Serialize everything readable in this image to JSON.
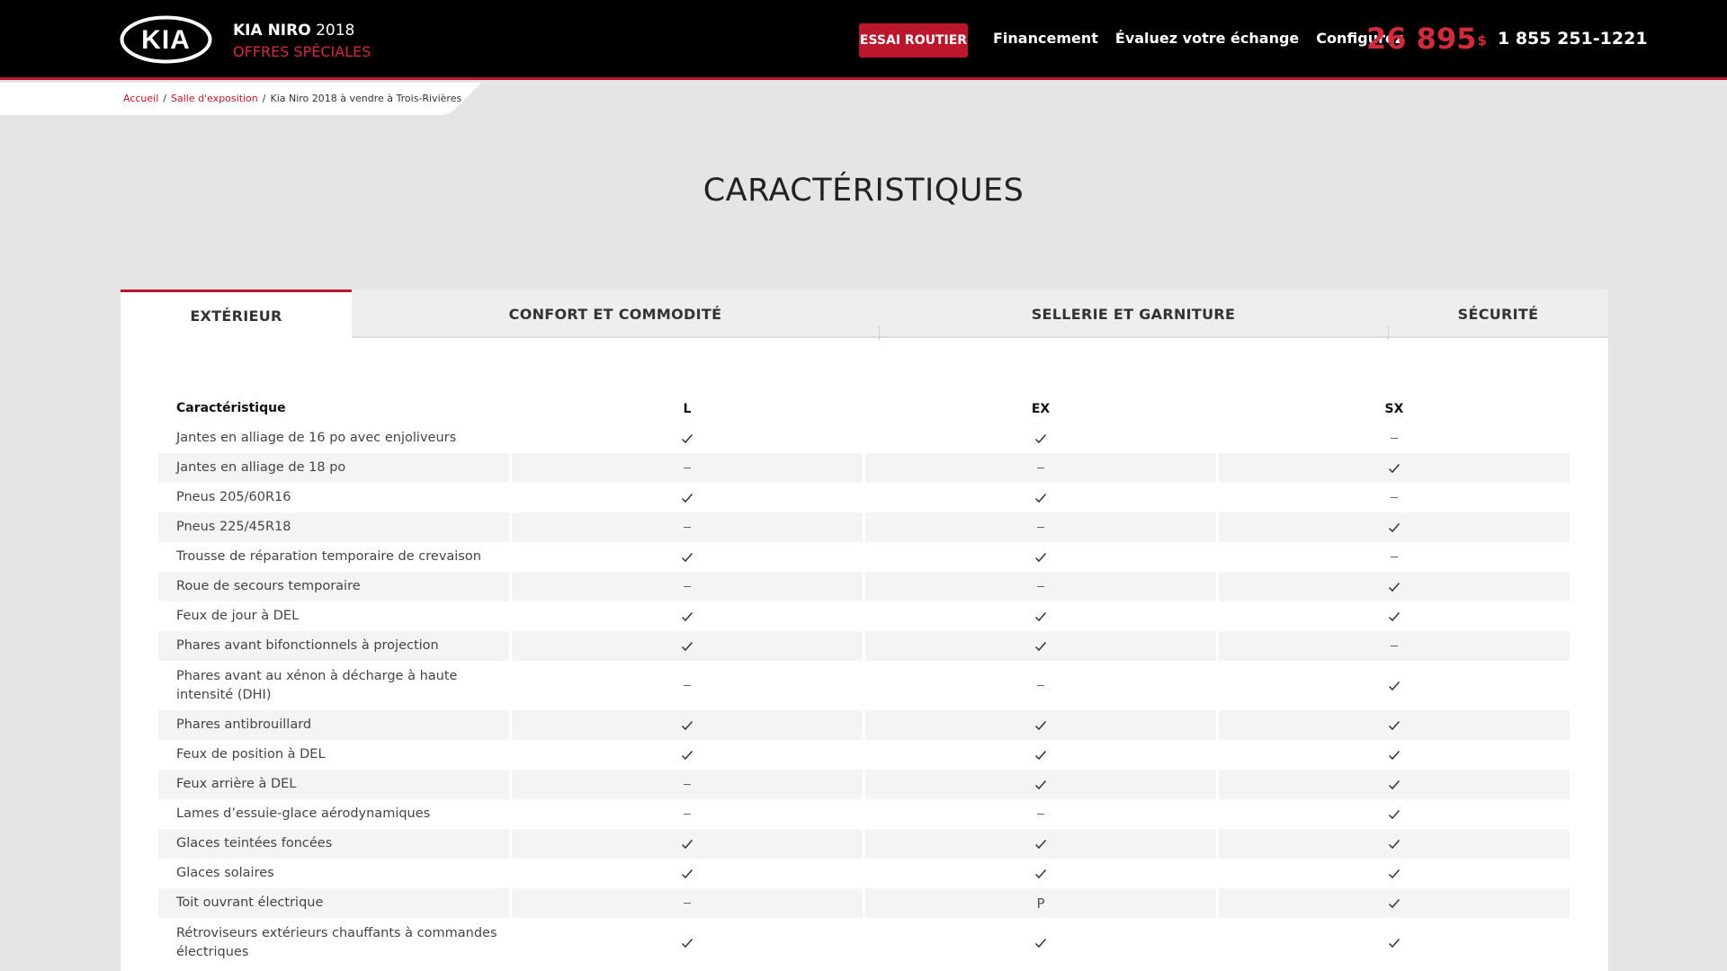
{
  "header": {
    "brand": "KIA",
    "model_name": "KIA NIRO",
    "model_year": "2018",
    "subtitle": "OFFRES SPÉCIALES",
    "test_drive_label": "ESSAI ROUTIER",
    "nav": [
      "Financement",
      "Évaluez votre échange",
      "Configurez"
    ],
    "price": "26 895",
    "price_currency": "$",
    "phone": "1 855 251-1221"
  },
  "breadcrumb": {
    "items": [
      "Accueil",
      "Salle d'exposition",
      "Kia Niro 2018 à vendre à Trois-Rivières"
    ]
  },
  "page_title": "CARACTÉRISTIQUES",
  "tabs": [
    "EXTÉRIEUR",
    "CONFORT ET COMMODITÉ",
    "SELLERIE ET GARNITURE",
    "SÉCURITÉ"
  ],
  "active_tab": "EXTÉRIEUR",
  "table": {
    "headers": [
      "Caractéristique",
      "L",
      "EX",
      "SX"
    ],
    "rows": [
      {
        "label": "Jantes en alliage de 16 po avec enjoliveurs",
        "values": [
          "check",
          "check",
          "dash"
        ]
      },
      {
        "label": "Jantes en alliage de 18 po",
        "values": [
          "dash",
          "dash",
          "check"
        ]
      },
      {
        "label": "Pneus 205/60R16",
        "values": [
          "check",
          "check",
          "dash"
        ]
      },
      {
        "label": "Pneus 225/45R18",
        "values": [
          "dash",
          "dash",
          "check"
        ]
      },
      {
        "label": "Trousse de réparation temporaire de crevaison",
        "values": [
          "check",
          "check",
          "dash"
        ]
      },
      {
        "label": "Roue de secours temporaire",
        "values": [
          "dash",
          "dash",
          "check"
        ]
      },
      {
        "label": "Feux de jour à DEL",
        "values": [
          "check",
          "check",
          "check"
        ]
      },
      {
        "label": "Phares avant bifonctionnels à projection",
        "values": [
          "check",
          "check",
          "dash"
        ]
      },
      {
        "label": "Phares avant au xénon à décharge à haute intensité (DHI)",
        "values": [
          "dash",
          "dash",
          "check"
        ]
      },
      {
        "label": "Phares antibrouillard",
        "values": [
          "check",
          "check",
          "check"
        ]
      },
      {
        "label": "Feux de position à DEL",
        "values": [
          "check",
          "check",
          "check"
        ]
      },
      {
        "label": "Feux arrière à DEL",
        "values": [
          "dash",
          "check",
          "check"
        ]
      },
      {
        "label": "Lames d’essuie-glace aérodynamiques",
        "values": [
          "dash",
          "dash",
          "check"
        ]
      },
      {
        "label": "Glaces teintées foncées",
        "values": [
          "check",
          "check",
          "check"
        ]
      },
      {
        "label": "Glaces solaires",
        "values": [
          "check",
          "check",
          "check"
        ]
      },
      {
        "label": "Toit ouvrant électrique",
        "values": [
          "dash",
          "P",
          "check"
        ]
      },
      {
        "label": "Rétroviseurs extérieurs chauffants à commandes électriques",
        "values": [
          "check",
          "check",
          "check"
        ]
      }
    ]
  },
  "colors": {
    "brand_red": "#bb162b",
    "header_bg": "#000000",
    "page_bg": "#e5e5e5"
  }
}
